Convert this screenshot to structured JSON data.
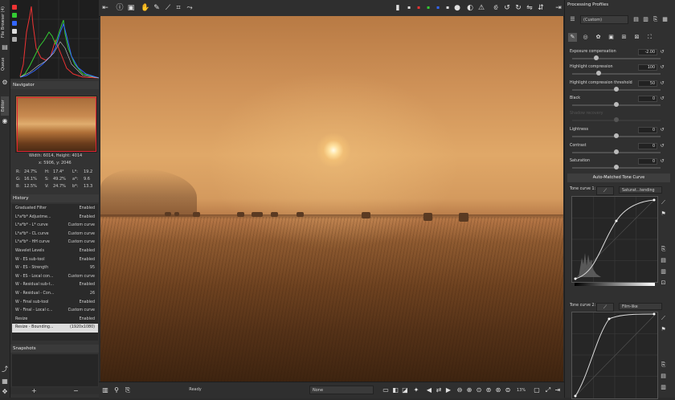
{
  "left_tabs": [
    "File Browser (4)",
    "Queue",
    "Editor"
  ],
  "histogram_swatches": [
    "#e33",
    "#3c3",
    "#36f",
    "#ddd",
    "#aaa"
  ],
  "navigator": {
    "title": "Navigator",
    "dimensions": "Width: 6014, Height: 4014",
    "coords": "x: 5906, y: 2046",
    "readouts": [
      {
        "a": "R:",
        "av": "24.7%",
        "b": "H:",
        "bv": "17.4°",
        "c": "L*:",
        "cv": "19.2"
      },
      {
        "a": "G:",
        "av": "16.1%",
        "b": "S:",
        "bv": "49.2%",
        "c": "a*:",
        "cv": "9.6"
      },
      {
        "a": "B:",
        "av": "12.5%",
        "b": "V:",
        "bv": "24.7%",
        "c": "b*:",
        "cv": "13.3"
      }
    ]
  },
  "history": {
    "title": "History",
    "rows": [
      {
        "name": "Graduated Filter",
        "value": "Enabled"
      },
      {
        "name": "L*a*b* Adjustme...",
        "value": "Enabled"
      },
      {
        "name": "L*a*b* - L* curve",
        "value": "Custom curve"
      },
      {
        "name": "L*a*b* - CL curve",
        "value": "Custom curve"
      },
      {
        "name": "L*a*b* - HH curve",
        "value": "Custom curve"
      },
      {
        "name": "Wavelet Levels",
        "value": "Enabled"
      },
      {
        "name": "W - ES sub-tool",
        "value": "Enabled"
      },
      {
        "name": "W - ES - Strength",
        "value": "95"
      },
      {
        "name": "W - ES - Local con...",
        "value": "Custom curve"
      },
      {
        "name": "W - Residual sub-t...",
        "value": "Enabled"
      },
      {
        "name": "W - Residual - Con...",
        "value": "26"
      },
      {
        "name": "W - Final sub-tool",
        "value": "Enabled"
      },
      {
        "name": "W - Final - Local c...",
        "value": "Custom curve"
      },
      {
        "name": "Resize",
        "value": "Enabled"
      },
      {
        "name": "Resize - Bounding...",
        "value": "(1920x1080)"
      }
    ]
  },
  "snapshots": {
    "title": "Snapshots",
    "add": "+",
    "remove": "−"
  },
  "statusbar": {
    "status": "Ready",
    "filter": "None",
    "zoom": "13%"
  },
  "processing": {
    "title": "Processing Profiles",
    "profile": "(Custom)",
    "sliders": [
      {
        "label": "Exposure compensation",
        "value": "-2.00",
        "level": 0.27
      },
      {
        "label": "Highlight compression",
        "value": "100",
        "level": 0.3
      },
      {
        "label": "Highlight compression threshold",
        "value": "50",
        "level": 0.5
      },
      {
        "label": "Black",
        "value": "0",
        "level": 0.5
      },
      {
        "label": "Shadow recovery",
        "value": "",
        "level": 0.5,
        "disabled": true
      },
      {
        "label": "Lightness",
        "value": "0",
        "level": 0.5
      },
      {
        "label": "Contrast",
        "value": "0",
        "level": 0.5
      },
      {
        "label": "Saturation",
        "value": "0",
        "level": 0.5
      }
    ],
    "tone_curve_button": "Auto-Matched Tone Curve",
    "curve1": {
      "label": "Tone curve 1:",
      "mode": "Saturat...tending"
    },
    "curve2": {
      "label": "Tone curve 2:",
      "mode": "Film-like"
    }
  }
}
